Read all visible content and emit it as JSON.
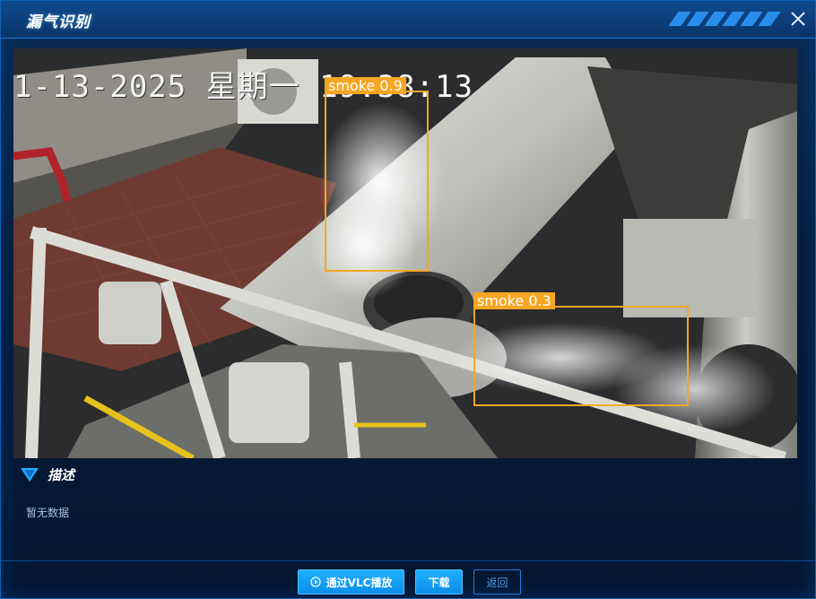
{
  "dialog": {
    "title": "漏气识别",
    "close_icon": "close-icon"
  },
  "video": {
    "timestamp": "1-13-2025  星期一  19:38:13",
    "detections": [
      {
        "label": "smoke 0.9"
      },
      {
        "label": "smoke 0.3"
      }
    ]
  },
  "description": {
    "heading": "描述",
    "text": "暂无数据"
  },
  "footer": {
    "vlc_button": "通过VLC播放",
    "download_button": "下载",
    "back_button": "返回"
  },
  "colors": {
    "accent": "#1fb0ff",
    "detection": "#f6a623"
  }
}
